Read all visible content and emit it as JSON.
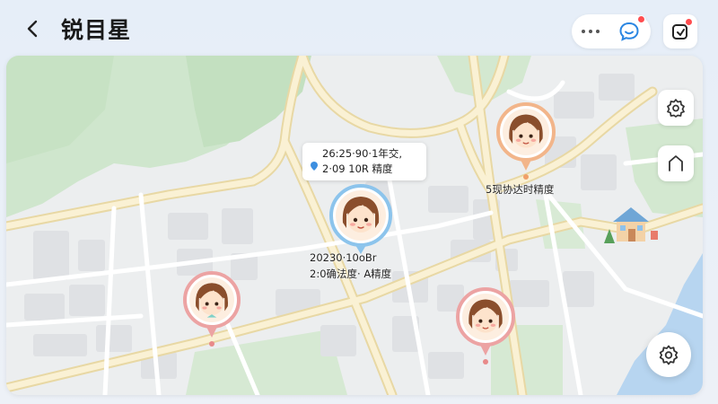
{
  "header": {
    "title": "锐目星",
    "icons": {
      "back": "chevron-left-icon",
      "more": "more-dots-icon",
      "message": "message-smile-icon",
      "share": "share-icon"
    }
  },
  "map": {
    "controls": {
      "top": "settings-cog-icon",
      "middle": "home-outline-icon",
      "fab": "gear-icon"
    },
    "info_card": {
      "line1": "26:25·90·1年交,",
      "line2": "2·09 10R  精度"
    },
    "labels": {
      "top_right": "5现协达时精度",
      "center_line1": "20230·10oBr",
      "center_line2": "2:0确法度·  A精度"
    },
    "accent_colors": {
      "selected_ring": "#8cc4ec",
      "orange_ring": "#f2b58a",
      "pink_ring": "#eca3a3",
      "pin_blue": "#3d8fe0",
      "badge_red": "#ff4d4f"
    }
  }
}
